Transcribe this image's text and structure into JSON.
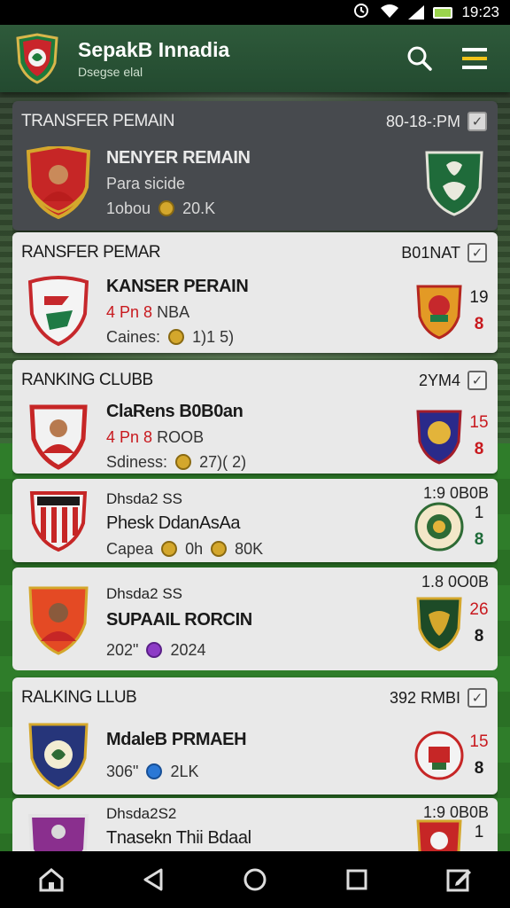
{
  "status": {
    "time": "19:23"
  },
  "app": {
    "title": "SepakB Innadia",
    "subtitle": "Dsegse elal"
  },
  "sections": [
    {
      "title": "TRANSFER PEMAIN",
      "meta": "80-18-:PM",
      "rows": [
        {
          "name": "NENYER REMAIN",
          "line1": "Para sicide",
          "line2_prefix": "1obou",
          "line2_value": "20.K"
        }
      ]
    },
    {
      "title": "RANSFER PEMAR",
      "meta": "B01NAT",
      "rows": [
        {
          "name": "KANSER PERAIN",
          "line1_red": "4 Pn",
          "line1_num": "8",
          "line1_rest": "NBA",
          "line2_prefix": "Caines:",
          "line2_value": "1)1 5)",
          "num_top": "19",
          "num_bottom": "8"
        }
      ]
    },
    {
      "title": "RANKING CLUBB",
      "meta": "2YM4",
      "rows": [
        {
          "name": "ClaRens B0B0an",
          "line1_red": "4 Pn",
          "line1_num": "8",
          "line1_rest": "ROOB",
          "line2_prefix": "Sdiness:",
          "line2_value": "27)( 2)",
          "num_top": "15",
          "num_bottom": "8"
        },
        {
          "sub_title": "Dhsda2 SS",
          "sub_meta": "1:9 0B0B",
          "name": "Phesk DdanAsAa",
          "line2_prefix": "Capea",
          "line2_mid": "0h",
          "line2_value": "80K",
          "num_top": "1",
          "num_bottom": "8"
        },
        {
          "sub_title": "Dhsda2 SS",
          "sub_meta": "1.8 0O0B",
          "name": "SUPAAIL RORCIN",
          "line2_prefix": "202\"",
          "line2_value": "2024",
          "num_top": "26",
          "num_bottom": "8"
        }
      ]
    },
    {
      "title": "RALKING LLUB",
      "meta": "392 RMBI",
      "rows": [
        {
          "name": "MdaleB PRMAEH",
          "line2_prefix": "306\"",
          "line2_value": "2LK",
          "num_top": "15",
          "num_bottom": "8"
        },
        {
          "sub_title": "Dhsda2S2",
          "sub_meta": "1:9 0B0B",
          "name": "Tnasekn Thii Bdaal",
          "num_top": "1"
        }
      ]
    }
  ],
  "colors": {
    "appbar": "#2e5a3a",
    "accent_red": "#c8191e",
    "coin_gold": "#d4a72c"
  },
  "icons": [
    "search-icon",
    "menu-icon",
    "home-icon",
    "back-icon",
    "circle-home-icon",
    "recents-icon",
    "edit-icon"
  ]
}
